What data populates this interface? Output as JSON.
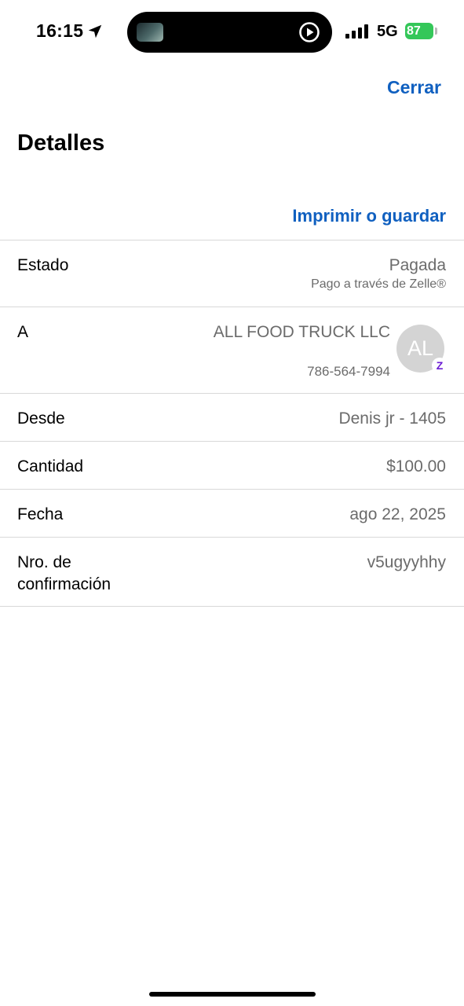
{
  "status_bar": {
    "time": "16:15",
    "network": "5G",
    "battery": "87"
  },
  "header": {
    "close_label": "Cerrar",
    "title": "Detalles",
    "print_label": "Imprimir o guardar"
  },
  "details": {
    "estado": {
      "label": "Estado",
      "value": "Pagada",
      "sub": "Pago a través de Zelle®"
    },
    "a": {
      "label": "A",
      "name": "ALL FOOD TRUCK LLC",
      "phone": "786-564-7994",
      "avatar_initials": "AL",
      "badge": "Z"
    },
    "desde": {
      "label": "Desde",
      "value": "Denis jr - 1405"
    },
    "cantidad": {
      "label": "Cantidad",
      "value": "$100.00"
    },
    "fecha": {
      "label": "Fecha",
      "value": "ago 22, 2025"
    },
    "confirmacion": {
      "label": "Nro. de confirmación",
      "value": "v5ugyyhhy"
    }
  },
  "colors": {
    "link": "#1060c0",
    "secondary_text": "#6b6b6b",
    "divider": "#d8d8d8",
    "battery": "#34c759",
    "zelle": "#6d1ed4"
  },
  "icons": [
    "location-arrow-icon",
    "play-circle-icon",
    "signal-bars-icon",
    "battery-icon",
    "zelle-icon"
  ]
}
